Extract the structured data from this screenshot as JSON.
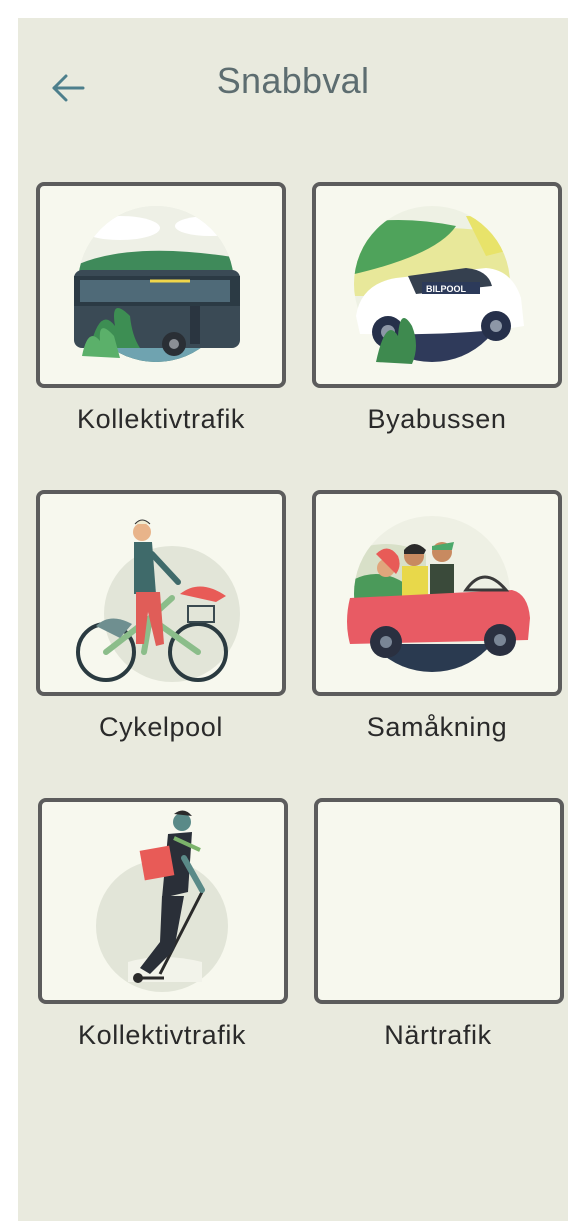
{
  "header": {
    "title": "Snabbval",
    "back_icon": "arrow-left-icon",
    "accent": "#4d7f8c"
  },
  "tiles": [
    {
      "label": "Kollektivtrafik",
      "icon": "bus-illustration"
    },
    {
      "label": "Byabussen",
      "icon": "car-illustration",
      "car_text": "BILPOOL"
    },
    {
      "label": "Cykelpool",
      "icon": "bicycle-illustration"
    },
    {
      "label": "Samåkning",
      "icon": "carpool-illustration"
    },
    {
      "label": "Kollektivtrafik",
      "icon": "scooter-illustration"
    },
    {
      "label": "Närtrafik",
      "icon": ""
    }
  ]
}
